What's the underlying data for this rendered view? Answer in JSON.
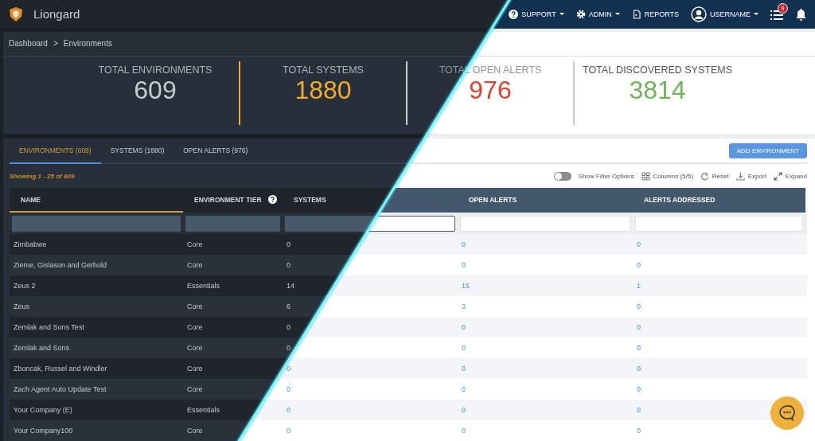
{
  "nav": {
    "brand": "Liongard",
    "menus": [
      {
        "kind": "help",
        "label": "SUPPORT",
        "dropdown": true
      },
      {
        "kind": "gear",
        "label": "ADMIN",
        "dropdown": true
      },
      {
        "kind": "document",
        "label": "REPORTS",
        "dropdown": false
      },
      {
        "kind": "user",
        "label": "USERNAME",
        "dropdown": true
      }
    ],
    "tasks_badge": "9"
  },
  "breadcrumb": {
    "items": [
      "Dashboard",
      "Environments"
    ],
    "separator": ">"
  },
  "stats": [
    {
      "label": "TOTAL ENVIRONMENTS",
      "value": "609",
      "color": "#c3cbd3"
    },
    {
      "label": "TOTAL SYSTEMS",
      "value": "1880",
      "color": "#f0ac2e"
    },
    {
      "label": "TOTAL OPEN ALERTS",
      "value": "976",
      "color": "#d9432c"
    },
    {
      "label": "TOTAL DISCOVERED SYSTEMS",
      "value": "3814",
      "color": "#6fb35a"
    }
  ],
  "tabs": [
    {
      "label": "ENVIRONMENTS (609)",
      "selected": true
    },
    {
      "label": "SYSTEMS (1880)",
      "selected": false
    },
    {
      "label": "OPEN ALERTS (976)",
      "selected": false
    }
  ],
  "add_button": "ADD ENVIRONMENT",
  "showing": "Showing 1 - 25 of 609",
  "toolbar": {
    "filter_toggle": {
      "label": "Show Filter Options",
      "on": false
    },
    "actions": [
      {
        "kind": "columns",
        "label": "Columns (5/5)"
      },
      {
        "kind": "reset",
        "label": "Reset"
      },
      {
        "kind": "export",
        "label": "Export"
      },
      {
        "kind": "expand",
        "label": "Expand"
      }
    ]
  },
  "table": {
    "columns": [
      {
        "label": "NAME",
        "sorted": true,
        "help": false,
        "kind": "text"
      },
      {
        "label": "ENVIRONMENT TIER",
        "sorted": false,
        "help": true,
        "kind": "text"
      },
      {
        "label": "SYSTEMS",
        "sorted": false,
        "help": false,
        "kind": "link"
      },
      {
        "label": "OPEN ALERTS",
        "sorted": false,
        "help": false,
        "kind": "link"
      },
      {
        "label": "ALERTS ADDRESSED",
        "sorted": false,
        "help": false,
        "kind": "link"
      }
    ],
    "rows": [
      [
        "Zimbabwe",
        "Core",
        "0",
        "0",
        "0"
      ],
      [
        "Zieme, Gislason and Gerhold",
        "Core",
        "0",
        "0",
        "0"
      ],
      [
        "Zeus 2",
        "Essentials",
        "14",
        "15",
        "1"
      ],
      [
        "Zeus",
        "Core",
        "6",
        "3",
        "0"
      ],
      [
        "Zemlak and Sons Test",
        "Core",
        "0",
        "0",
        "0"
      ],
      [
        "Zemlak and Sons",
        "Core",
        "0",
        "0",
        "0"
      ],
      [
        "Zboncak, Russel and Windler",
        "Core",
        "0",
        "0",
        "0"
      ],
      [
        "Zach Agent Auto Update Test",
        "Core",
        "0",
        "0",
        "0"
      ],
      [
        "Your Company (E)",
        "Essentials",
        "0",
        "0",
        "0"
      ],
      [
        "Your Company100",
        "Core",
        "0",
        "0",
        "0"
      ]
    ]
  }
}
